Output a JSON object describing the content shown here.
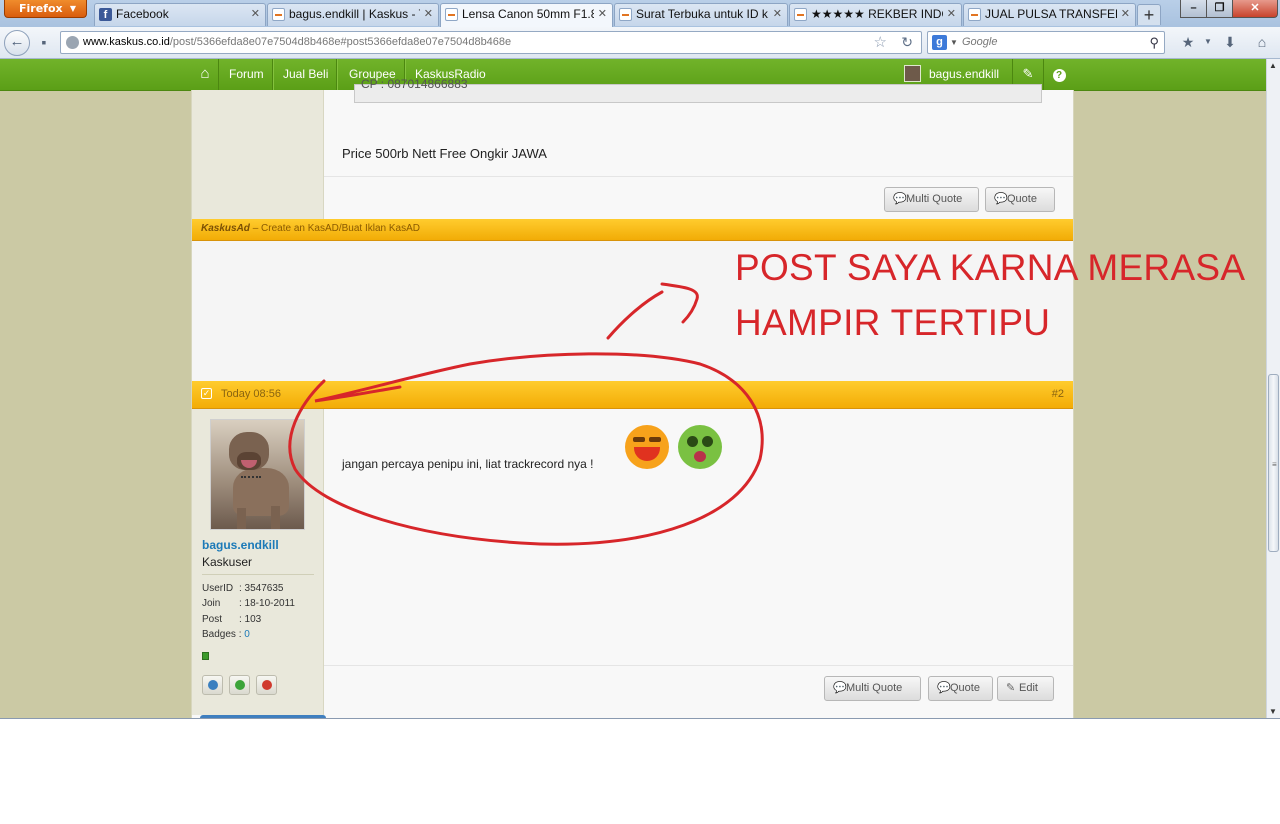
{
  "browser": {
    "app_button": "Firefox",
    "tabs": [
      {
        "label": "Facebook",
        "icon": "facebook-icon",
        "active": false
      },
      {
        "label": "bagus.endkill | Kaskus - T...",
        "icon": "kaskus-icon",
        "active": false
      },
      {
        "label": "Lensa Canon 50mm F1.8 ...",
        "icon": "kaskus-icon",
        "active": true
      },
      {
        "label": "Surat Terbuka untuk ID k...",
        "icon": "kaskus-icon",
        "active": false
      },
      {
        "label": "★★★★★ REKBER INDOB...",
        "icon": "kaskus-icon",
        "active": false
      },
      {
        "label": "JUAL PULSA TRANSFER ...",
        "icon": "kaskus-icon",
        "active": false
      }
    ],
    "url_domain": "www.kaskus.co.id",
    "url_path": "/post/5366efda8e07e7504d8b468e#post5366efda8e07e7504d8b468e",
    "search_placeholder": "Google"
  },
  "site_nav": {
    "items": [
      "Forum",
      "Jual Beli",
      "Groupee",
      "KaskusRadio"
    ],
    "username": "bagus.endkill"
  },
  "post1": {
    "price_text": "Price 500rb Nett Free Ongkir JAWA",
    "quote_box_text": "CP : 087014866883",
    "multi_quote_label": "Multi Quote",
    "quote_label": "Quote"
  },
  "kasad": {
    "brand": "KaskusAd",
    "text": "– Create an KasAD/Buat Iklan KasAD"
  },
  "post2": {
    "time": "Today 08:56",
    "number": "#2",
    "message": "jangan percaya penipu ini, liat trackrecord nya !",
    "user": {
      "name": "bagus.endkill",
      "title": "Kaskuser",
      "userid_label": "UserID",
      "userid": ": 3547635",
      "join_label": "Join",
      "join": ": 18-10-2011",
      "post_label": "Post",
      "post": ": 103",
      "badges_label": "Badges",
      "badges": "0"
    },
    "multi_quote_label": "Multi Quote",
    "quote_label": "Quote",
    "edit_label": "Edit"
  },
  "annotation": {
    "line1": "POST SAYA KARNA MERASA",
    "line2": "HAMPIR TERTIPU",
    "color": "#d7262a"
  }
}
